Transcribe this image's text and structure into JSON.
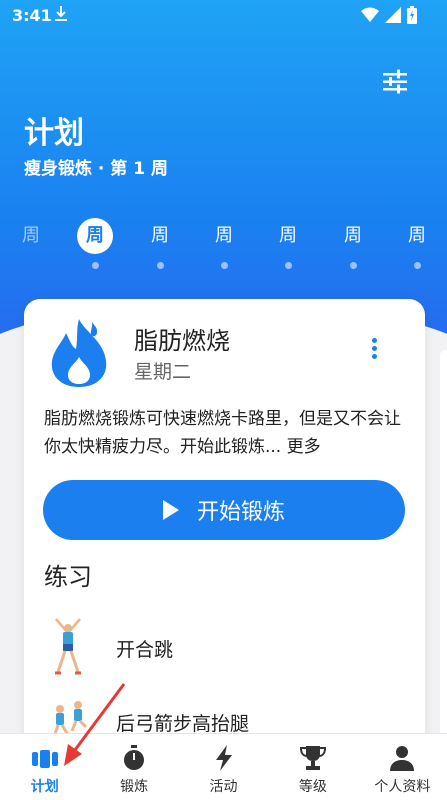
{
  "status_bar": {
    "time": "3:41"
  },
  "header": {
    "title": "计划",
    "subtitle": "瘦身锻炼 · 第 1 周"
  },
  "weeks": [
    {
      "label": "周",
      "state": "faded"
    },
    {
      "label": "周",
      "state": "active"
    },
    {
      "label": "周",
      "state": "normal"
    },
    {
      "label": "周",
      "state": "normal"
    },
    {
      "label": "周",
      "state": "normal"
    },
    {
      "label": "周",
      "state": "normal"
    },
    {
      "label": "周",
      "state": "normal"
    }
  ],
  "workout_card": {
    "title": "脂肪燃烧",
    "day": "星期二",
    "description": "脂肪燃烧锻炼可快速燃烧卡路里，但是又不会让你太快精疲力尽。开始此锻炼...",
    "more_link": "更多",
    "start_button": "开始锻炼",
    "section_title": "练习",
    "exercises": [
      {
        "name": "开合跳"
      },
      {
        "name": "后弓箭步高抬腿"
      }
    ]
  },
  "bottom_nav": {
    "items": [
      {
        "label": "计划",
        "icon": "plan-icon",
        "active": true
      },
      {
        "label": "锻炼",
        "icon": "stopwatch-icon",
        "active": false
      },
      {
        "label": "活动",
        "icon": "lightning-icon",
        "active": false
      },
      {
        "label": "等级",
        "icon": "trophy-icon",
        "active": false
      },
      {
        "label": "个人资料",
        "icon": "person-icon",
        "active": false
      }
    ]
  },
  "colors": {
    "primary": "#1a80f0",
    "annotation": "#e53935"
  }
}
